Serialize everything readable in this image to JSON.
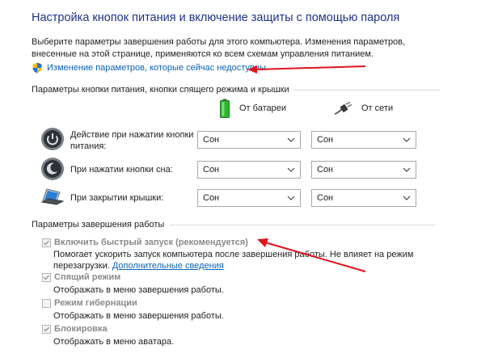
{
  "page": {
    "title": "Настройка кнопок питания и включение защиты с помощью пароля",
    "description": "Выберите параметры завершения работы для этого компьютера. Изменения параметров, внесенные на этой странице, применяются ко всем схемам управления питанием.",
    "change_link": "Изменение параметров, которые сейчас недоступны"
  },
  "power_buttons": {
    "section_title": "Параметры кнопки питания, кнопки спящего режима и крышки",
    "col_battery": "От батареи",
    "col_ac": "От сети",
    "rows": [
      {
        "label_line1": "Действие при нажатии кнопки",
        "label_line2": "питания:",
        "battery": "Сон",
        "ac": "Сон"
      },
      {
        "label_line1": "При нажатии кнопки сна:",
        "label_line2": "",
        "battery": "Сон",
        "ac": "Сон"
      },
      {
        "label_line1": "При закрытии крышки:",
        "label_line2": "",
        "battery": "Сон",
        "ac": "Сон"
      }
    ]
  },
  "shutdown": {
    "section_title": "Параметры завершения работы",
    "fast_startup": {
      "label": "Включить быстрый запуск (рекомендуется)",
      "desc_line1": "Помогает ускорить запуск компьютера после завершения работы. Не влияет на режим",
      "desc_line2": "перезагрузки.",
      "more_link": "Дополнительные сведения",
      "checked": true
    },
    "sleep": {
      "label": "Спящий режим",
      "desc": "Отображать в меню завершения работы.",
      "checked": true
    },
    "hibernate": {
      "label": "Режим гибернации",
      "desc": "Отображать в меню завершения работы.",
      "checked": false
    },
    "lock": {
      "label": "Блокировка",
      "desc": "Отображать в меню аватара.",
      "checked": true
    }
  },
  "colors": {
    "title": "#1e3287",
    "link": "#0b62b6",
    "arrow": "#e0141e",
    "battery": "#2fb52f"
  }
}
